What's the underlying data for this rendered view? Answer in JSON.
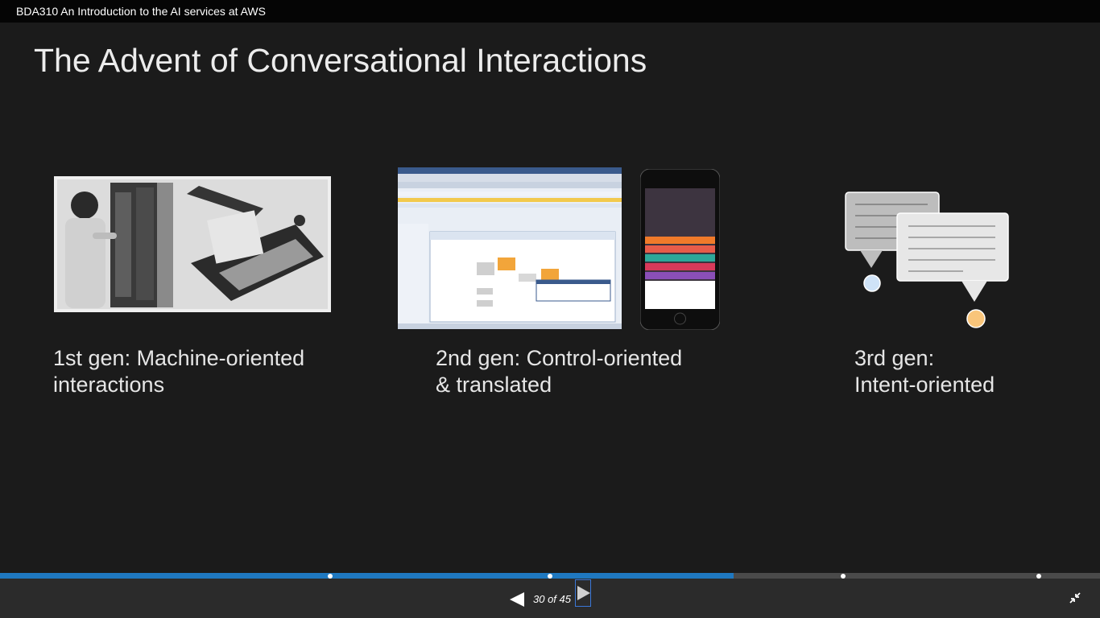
{
  "window": {
    "title": "BDA310 An Introduction to the AI services at AWS"
  },
  "slide": {
    "title": "The Advent of Conversational Interactions",
    "columns": [
      {
        "line1": "1st gen: Machine-oriented",
        "line2": "interactions",
        "image_icon": "vintage-computer-photo"
      },
      {
        "line1": "2nd gen: Control-oriented",
        "line2": "& translated",
        "image_icon": "desktop-app-and-phone-screenshot"
      },
      {
        "line1": "3rd gen:",
        "line2": "Intent-oriented",
        "image_icon": "chat-bubbles-icon"
      }
    ]
  },
  "player": {
    "counter": "30 of 45",
    "progress": 0.667,
    "accent_color": "#1f78c0",
    "prev_icon": "previous-triangle-icon",
    "next_icon": "next-triangle-icon",
    "exit_fullscreen_icon": "exit-fullscreen-icon"
  }
}
